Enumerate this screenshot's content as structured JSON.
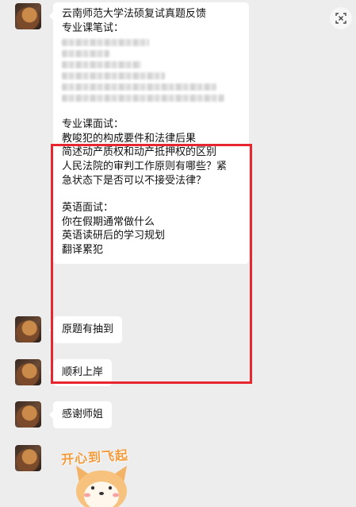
{
  "close_button": {
    "icon": "close-icon"
  },
  "messages": [
    {
      "id": "m1",
      "lines": [
        "云南师范大学法硕复试真题反馈",
        "专业课笔试："
      ],
      "redacted_lines": 6,
      "lines2": [
        "专业课面试：",
        "教唆犯的构成要件和法律后果",
        "简述动产质权和动产抵押权的区别",
        "人民法院的审判工作原则有哪些？紧",
        "急状态下是否可以不接受法律？"
      ],
      "lines3": [
        "英语面试：",
        "你在假期通常做什么",
        "英语读研后的学习规划",
        "翻译累犯"
      ]
    },
    {
      "id": "m2",
      "text": "原题有抽到"
    },
    {
      "id": "m3",
      "text": "顺利上岸"
    },
    {
      "id": "m4",
      "text": "感谢师姐"
    }
  ],
  "sticker": {
    "caption": "开心到飞起"
  },
  "colors": {
    "background": "#ededed",
    "bubble": "#ffffff",
    "highlight": "#e8262f"
  }
}
